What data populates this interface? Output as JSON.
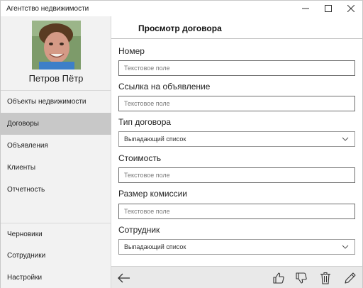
{
  "window": {
    "title": "Агентство недвижимости",
    "controls": [
      "minimize-icon",
      "maximize-icon",
      "close-icon"
    ]
  },
  "sidebar": {
    "user_name": "Петров Пётр",
    "items_top": [
      {
        "label": "Объекты недвижимости",
        "active": false
      },
      {
        "label": "Договоры",
        "active": true
      },
      {
        "label": "Объявления",
        "active": false
      },
      {
        "label": "Клиенты",
        "active": false
      },
      {
        "label": "Отчетность",
        "active": false
      }
    ],
    "items_bottom": [
      {
        "label": "Черновики"
      },
      {
        "label": "Сотрудники"
      },
      {
        "label": "Настройки"
      }
    ]
  },
  "main": {
    "title": "Просмотр договора",
    "fields": [
      {
        "label": "Номер",
        "type": "text",
        "placeholder": "Текстовое поле"
      },
      {
        "label": "Ссылка на объявление",
        "type": "text",
        "placeholder": "Текстовое поле"
      },
      {
        "label": "Тип договора",
        "type": "select",
        "value": "Выпадающий список"
      },
      {
        "label": "Стоимость",
        "type": "text",
        "placeholder": "Текстовое поле"
      },
      {
        "label": "Размер комиссии",
        "type": "text",
        "placeholder": "Текстовое поле"
      },
      {
        "label": "Сотрудник",
        "type": "select",
        "value": "Выпадающий список"
      }
    ]
  },
  "bottombar": {
    "buttons": [
      "back-arrow-icon",
      "thumbs-up-icon",
      "thumbs-down-icon",
      "trash-icon",
      "pencil-icon"
    ]
  },
  "colors": {
    "sidebar_bg": "#f2f2f2",
    "active_item_bg": "#c8c8c8",
    "bottombar_bg": "#e9e9e9"
  }
}
